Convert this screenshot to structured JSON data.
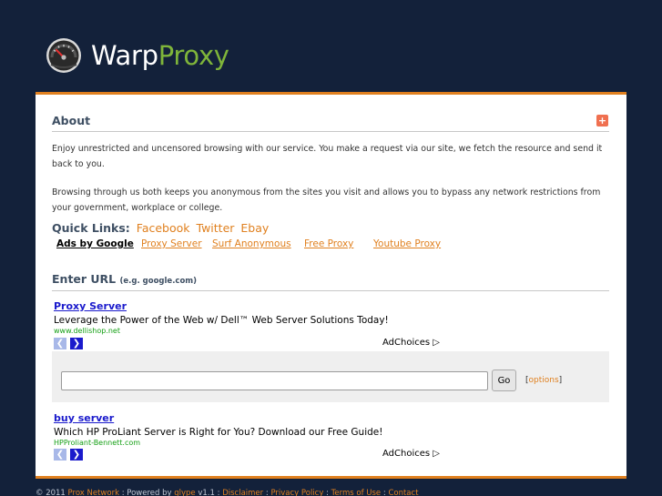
{
  "logo": {
    "warp": "Warp",
    "proxy": "Proxy",
    "icon": "gauge-icon"
  },
  "about": {
    "title": "About",
    "collapse_icon": "+",
    "p1": "Enjoy unrestricted and uncensored browsing with our service. You make a request via our site, we fetch the resource and send it back to you.",
    "p2": "Browsing through us both keeps you anonymous from the sites you visit and allows you to bypass any network restrictions from your government, workplace or college."
  },
  "quick_links": {
    "label": "Quick Links:",
    "items": [
      "Facebook",
      "Twitter",
      "Ebay"
    ]
  },
  "ad_links": {
    "ads_by": "Ads by Google",
    "items": [
      "Proxy Server",
      "Surf Anonymous",
      "Free Proxy",
      "Youtube Proxy"
    ]
  },
  "enter_url": {
    "title": "Enter URL",
    "hint": "(e.g. google.com)"
  },
  "ad1": {
    "title": "Proxy Server",
    "text": "Leverage the Power of the Web w/ Dell™ Web Server Solutions Today!",
    "url": "www.dellishop.net"
  },
  "ad2": {
    "title": "buy server",
    "text": "Which HP ProLiant Server is Right for You? Download our Free Guide!",
    "url": "HPProliant-Bennett.com"
  },
  "adchoices": "AdChoices",
  "form": {
    "url_value": "",
    "go_label": "Go",
    "options_open": "[",
    "options_label": "options",
    "options_close": "]"
  },
  "footer": {
    "copyright": "© 2011",
    "prox_network": "Prox Network",
    "powered_by": " : Powered by ",
    "glype": "glype",
    "version": " v1.1 : ",
    "disclaimer": "Disclaimer",
    "sep1": " : ",
    "privacy": "Privacy Policy",
    "sep2": " : ",
    "terms": "Terms of Use",
    "sep3": " : ",
    "contact": "Contact"
  },
  "colors": {
    "background": "#13213a",
    "accent": "#e0801f",
    "logo_green": "#7fb53a",
    "ad_link": "#1a1acc"
  }
}
